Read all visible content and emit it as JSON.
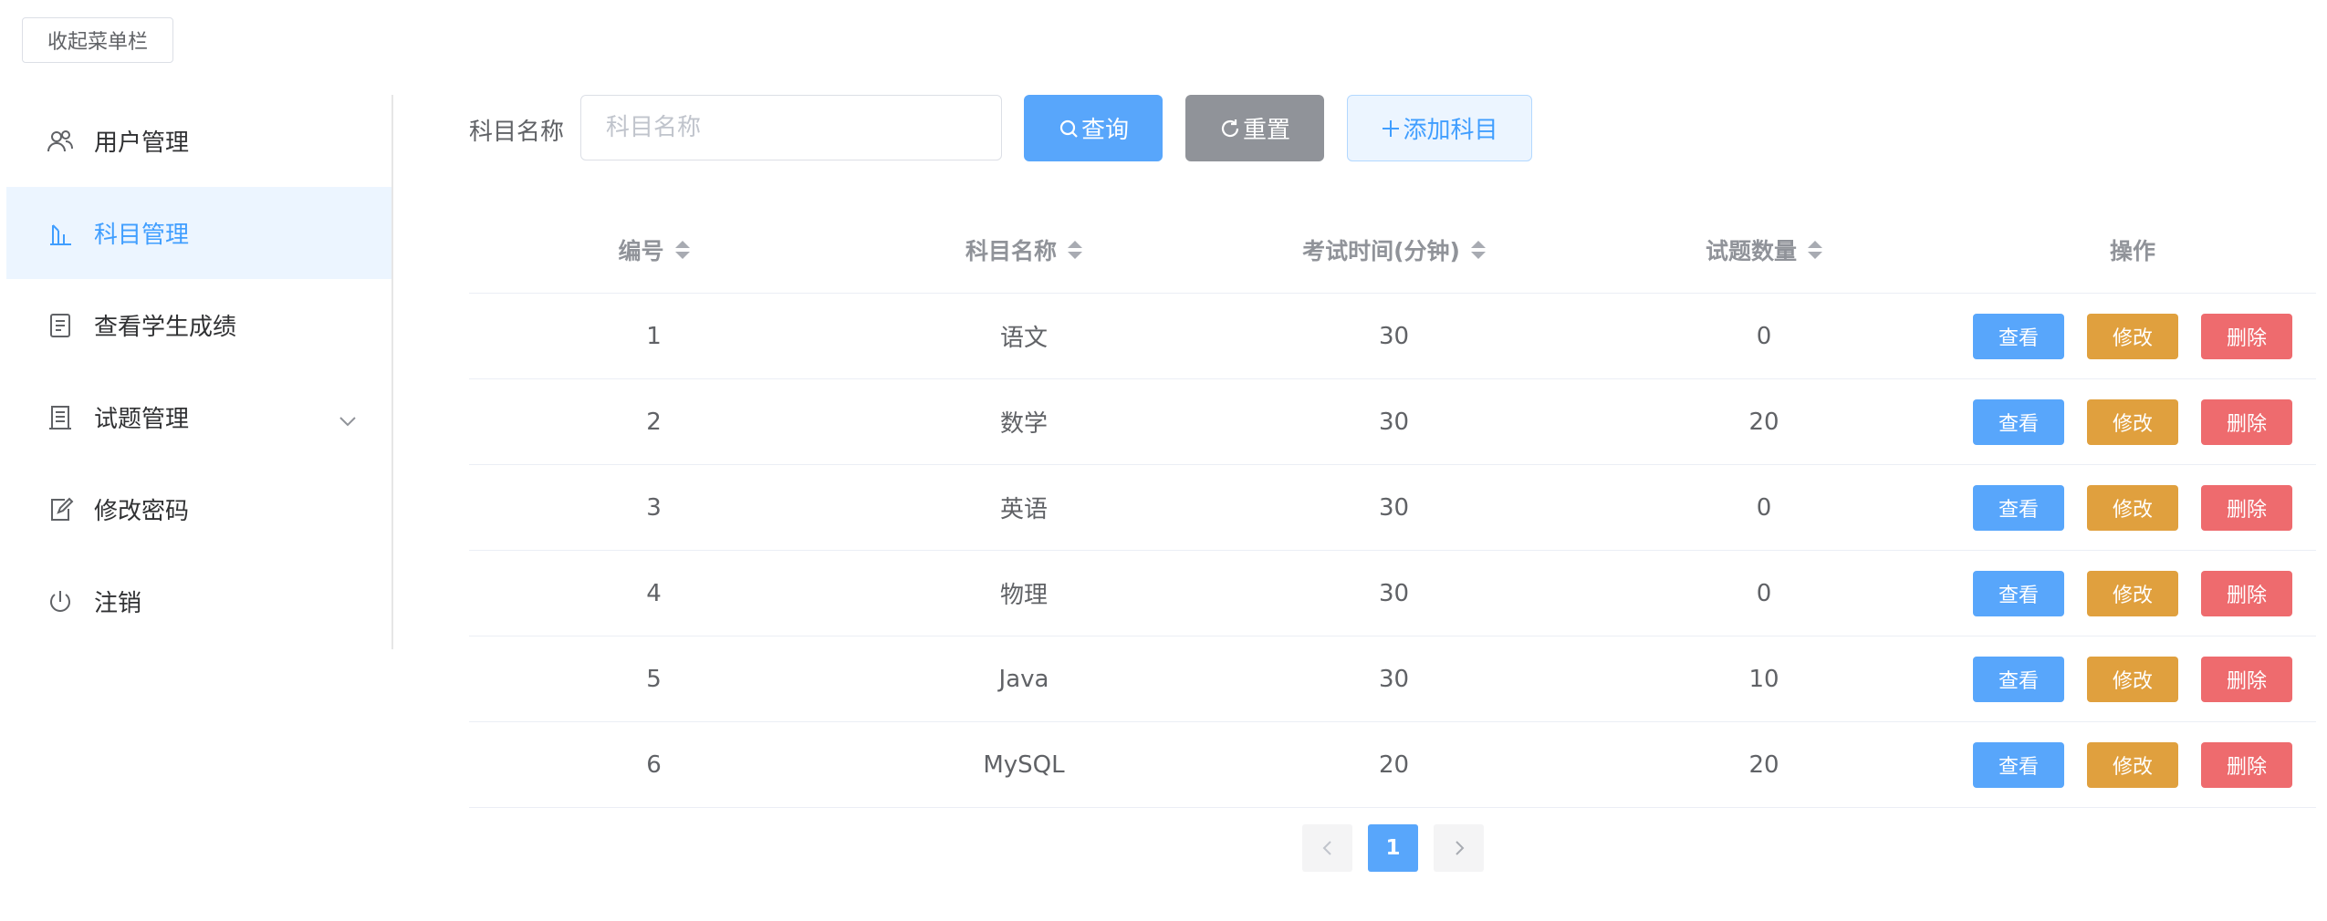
{
  "collapse_button": "收起菜单栏",
  "sidebar": {
    "items": [
      {
        "label": "用户管理",
        "icon": "users-icon",
        "active": false
      },
      {
        "label": "科目管理",
        "icon": "chart-icon",
        "active": true
      },
      {
        "label": "查看学生成绩",
        "icon": "document-icon",
        "active": false
      },
      {
        "label": "试题管理",
        "icon": "exam-icon",
        "active": false,
        "expandable": true
      },
      {
        "label": "修改密码",
        "icon": "edit-icon",
        "active": false
      },
      {
        "label": "注销",
        "icon": "power-icon",
        "active": false
      }
    ]
  },
  "search": {
    "label": "科目名称",
    "placeholder": "科目名称",
    "value": "",
    "query_label": "查询",
    "reset_label": "重置",
    "add_label": "添加科目"
  },
  "table": {
    "headers": [
      "编号",
      "科目名称",
      "考试时间(分钟)",
      "试题数量",
      "操作"
    ],
    "rows": [
      {
        "id": "1",
        "name": "语文",
        "time": "30",
        "count": "0"
      },
      {
        "id": "2",
        "name": "数学",
        "time": "30",
        "count": "20"
      },
      {
        "id": "3",
        "name": "英语",
        "time": "30",
        "count": "0"
      },
      {
        "id": "4",
        "name": "物理",
        "time": "30",
        "count": "0"
      },
      {
        "id": "5",
        "name": "Java",
        "time": "30",
        "count": "10"
      },
      {
        "id": "6",
        "name": "MySQL",
        "time": "20",
        "count": "20"
      }
    ],
    "actions": {
      "view": "查看",
      "edit": "修改",
      "delete": "删除"
    }
  },
  "pagination": {
    "current": "1",
    "prev_icon": "chevron-left-icon",
    "next_icon": "chevron-right-icon"
  },
  "colors": {
    "primary": "#58a6fb",
    "warning": "#e0a03e",
    "danger": "#ee6b6e",
    "info": "#909399",
    "active_bg": "#ecf5ff"
  }
}
